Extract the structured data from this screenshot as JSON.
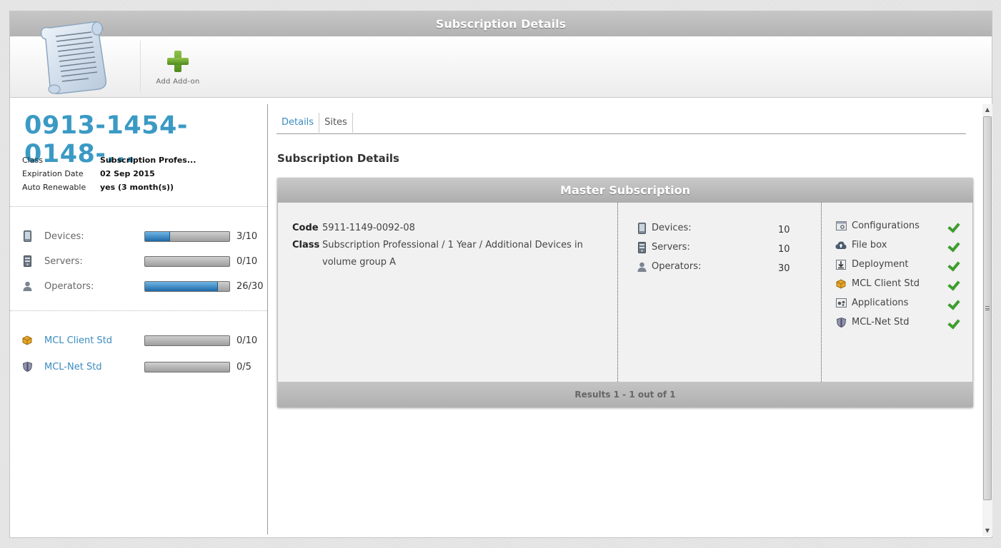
{
  "window": {
    "title": "Subscription Details"
  },
  "toolbar": {
    "add_addon_label": "Add Add-on",
    "icon": "scroll-icon"
  },
  "subscription": {
    "id_display": "0913-1454-0148-...",
    "info": [
      {
        "key": "Class",
        "value": "Subscription Profes..."
      },
      {
        "key": "Expiration Date",
        "value": "02 Sep 2015"
      },
      {
        "key": "Auto Renewable",
        "value": "yes (3 month(s))"
      }
    ]
  },
  "usage": [
    {
      "name": "Devices:",
      "count": "3/10",
      "fraction": 0.3,
      "icon": "device-icon"
    },
    {
      "name": "Servers:",
      "count": "0/10",
      "fraction": 0.0,
      "icon": "server-icon"
    },
    {
      "name": "Operators:",
      "count": "26/30",
      "fraction": 0.867,
      "icon": "operator-icon"
    }
  ],
  "addons": [
    {
      "name": "MCL Client Std",
      "count": "0/10",
      "fraction": 0.0,
      "icon": "client-box-icon"
    },
    {
      "name": "MCL-Net Std",
      "count": "0/5",
      "fraction": 0.0,
      "icon": "shield-icon"
    }
  ],
  "tabs": [
    {
      "label": "Details",
      "active": true
    },
    {
      "label": "Sites",
      "active": false
    }
  ],
  "main": {
    "section_title": "Subscription Details",
    "panel_title": "Master Subscription",
    "code_label": "Code",
    "code_value": "5911-1149-0092-08",
    "class_label": "Class",
    "class_value": "Subscription Professional / 1 Year / Additional Devices in volume group A",
    "limits": [
      {
        "label": "Devices:",
        "value": "10",
        "icon": "device-icon"
      },
      {
        "label": "Servers:",
        "value": "10",
        "icon": "server-icon"
      },
      {
        "label": "Operators:",
        "value": "30",
        "icon": "operator-icon"
      }
    ],
    "features": [
      {
        "label": "Configurations",
        "icon": "configurations-icon",
        "enabled": true
      },
      {
        "label": "File box",
        "icon": "cloud-upload-icon",
        "enabled": true
      },
      {
        "label": "Deployment",
        "icon": "deployment-icon",
        "enabled": true
      },
      {
        "label": "MCL Client Std",
        "icon": "client-box-icon",
        "enabled": true
      },
      {
        "label": "Applications",
        "icon": "applications-icon",
        "enabled": true
      },
      {
        "label": "MCL-Net Std",
        "icon": "shield-icon",
        "enabled": true
      }
    ],
    "results_text": "Results 1 - 1 out of 1"
  },
  "colors": {
    "accent": "#3b9ac4",
    "progress": "#2a7ab8",
    "check": "#3e9d2d"
  }
}
